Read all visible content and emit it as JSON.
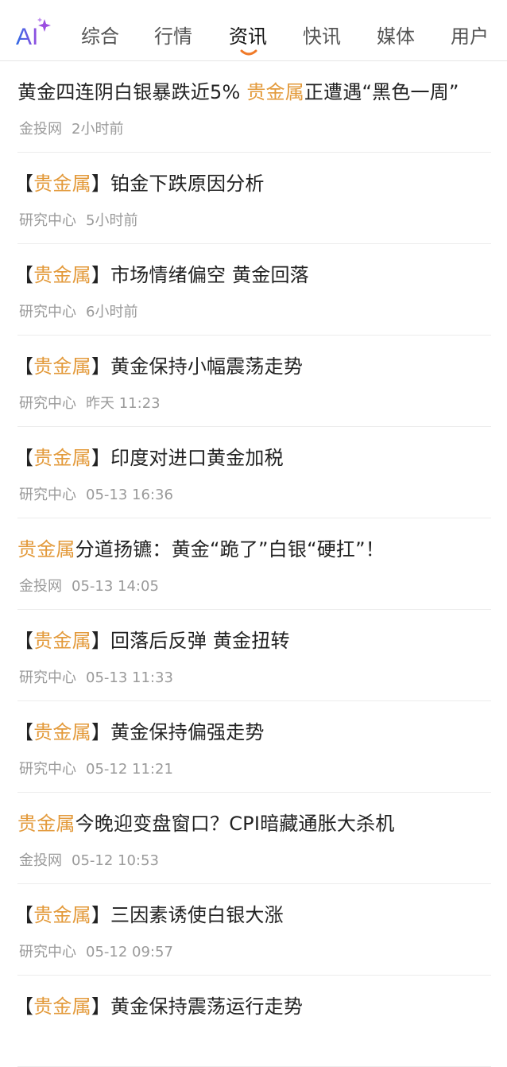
{
  "header": {
    "logo_text": "AI",
    "tabs": [
      {
        "label": "综合",
        "active": false
      },
      {
        "label": "行情",
        "active": false
      },
      {
        "label": "资讯",
        "active": true
      },
      {
        "label": "快讯",
        "active": false
      },
      {
        "label": "媒体",
        "active": false
      },
      {
        "label": "用户",
        "active": false
      }
    ]
  },
  "colors": {
    "highlight": "#e39a3b",
    "indicator": "#f07a28",
    "logo_blue": "#2f6be5",
    "logo_purple": "#9b4de0"
  },
  "news": [
    {
      "prefix": "黄金四连阴白银暴跌近5% ",
      "highlight": "贵金属",
      "suffix": "正遭遇“黑色一周”",
      "bracket": false,
      "source": "金投网",
      "time": "2小时前"
    },
    {
      "prefix": "",
      "highlight": "贵金属",
      "suffix": "铂金下跌原因分析",
      "bracket": true,
      "source": "研究中心",
      "time": "5小时前"
    },
    {
      "prefix": "",
      "highlight": "贵金属",
      "suffix": "市场情绪偏空 黄金回落",
      "bracket": true,
      "source": "研究中心",
      "time": "6小时前"
    },
    {
      "prefix": "",
      "highlight": "贵金属",
      "suffix": "黄金保持小幅震荡走势",
      "bracket": true,
      "source": "研究中心",
      "time": "昨天 11:23"
    },
    {
      "prefix": "",
      "highlight": "贵金属",
      "suffix": "印度对进口黄金加税",
      "bracket": true,
      "source": "研究中心",
      "time": "05-13 16:36"
    },
    {
      "prefix": "",
      "highlight": "贵金属",
      "suffix": "分道扬镳：黄金“跪了”白银“硬扛”！",
      "bracket": false,
      "source": "金投网",
      "time": "05-13 14:05"
    },
    {
      "prefix": "",
      "highlight": "贵金属",
      "suffix": "回落后反弹 黄金扭转",
      "bracket": true,
      "source": "研究中心",
      "time": "05-13 11:33"
    },
    {
      "prefix": "",
      "highlight": "贵金属",
      "suffix": "黄金保持偏强走势",
      "bracket": true,
      "source": "研究中心",
      "time": "05-12 11:21"
    },
    {
      "prefix": "",
      "highlight": "贵金属",
      "suffix": "今晚迎变盘窗口？CPI暗藏通胀大杀机",
      "bracket": false,
      "source": "金投网",
      "time": "05-12 10:53"
    },
    {
      "prefix": "",
      "highlight": "贵金属",
      "suffix": "三因素诱使白银大涨",
      "bracket": true,
      "source": "研究中心",
      "time": "05-12 09:57"
    },
    {
      "prefix": "",
      "highlight": "贵金属",
      "suffix": "黄金保持震荡运行走势",
      "bracket": true,
      "source": "",
      "time": ""
    }
  ]
}
